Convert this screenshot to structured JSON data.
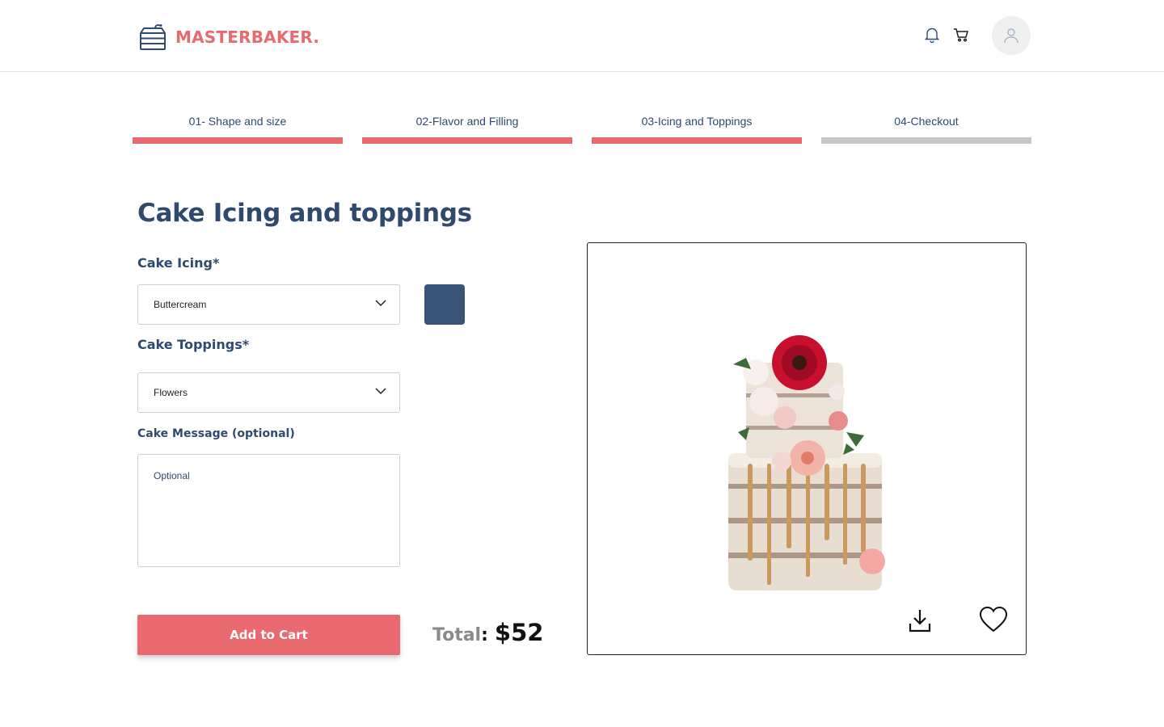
{
  "brand": {
    "name": "MASTERBAKER.",
    "color": "#e86a6f"
  },
  "header": {
    "icons": [
      "bell-icon",
      "cart-icon",
      "user-icon"
    ]
  },
  "stepper": {
    "steps": [
      {
        "label": "01- Shape and size",
        "complete": true
      },
      {
        "label": "02-Flavor and Filling",
        "complete": true
      },
      {
        "label": "03-Icing and Toppings",
        "complete": true
      },
      {
        "label": "04-Checkout",
        "complete": false
      }
    ],
    "active_color": "#e86a6f",
    "inactive_color": "#c6c6c6"
  },
  "page": {
    "title": "Cake Icing and toppings"
  },
  "form": {
    "icing": {
      "label": "Cake Icing*",
      "value": "Buttercream",
      "swatch_color": "#3a5478"
    },
    "toppings": {
      "label": "Cake Toppings*",
      "value": "Flowers"
    },
    "message": {
      "label": "Cake Message (optional)",
      "placeholder": "Optional",
      "value": ""
    }
  },
  "actions": {
    "add_to_cart": "Add to Cart"
  },
  "total": {
    "label": "Total",
    "colon": ":",
    "value": "$52"
  },
  "preview": {
    "image": "two-tier-naked-cake-with-flowers",
    "icons": [
      "download-icon",
      "heart-icon"
    ]
  }
}
